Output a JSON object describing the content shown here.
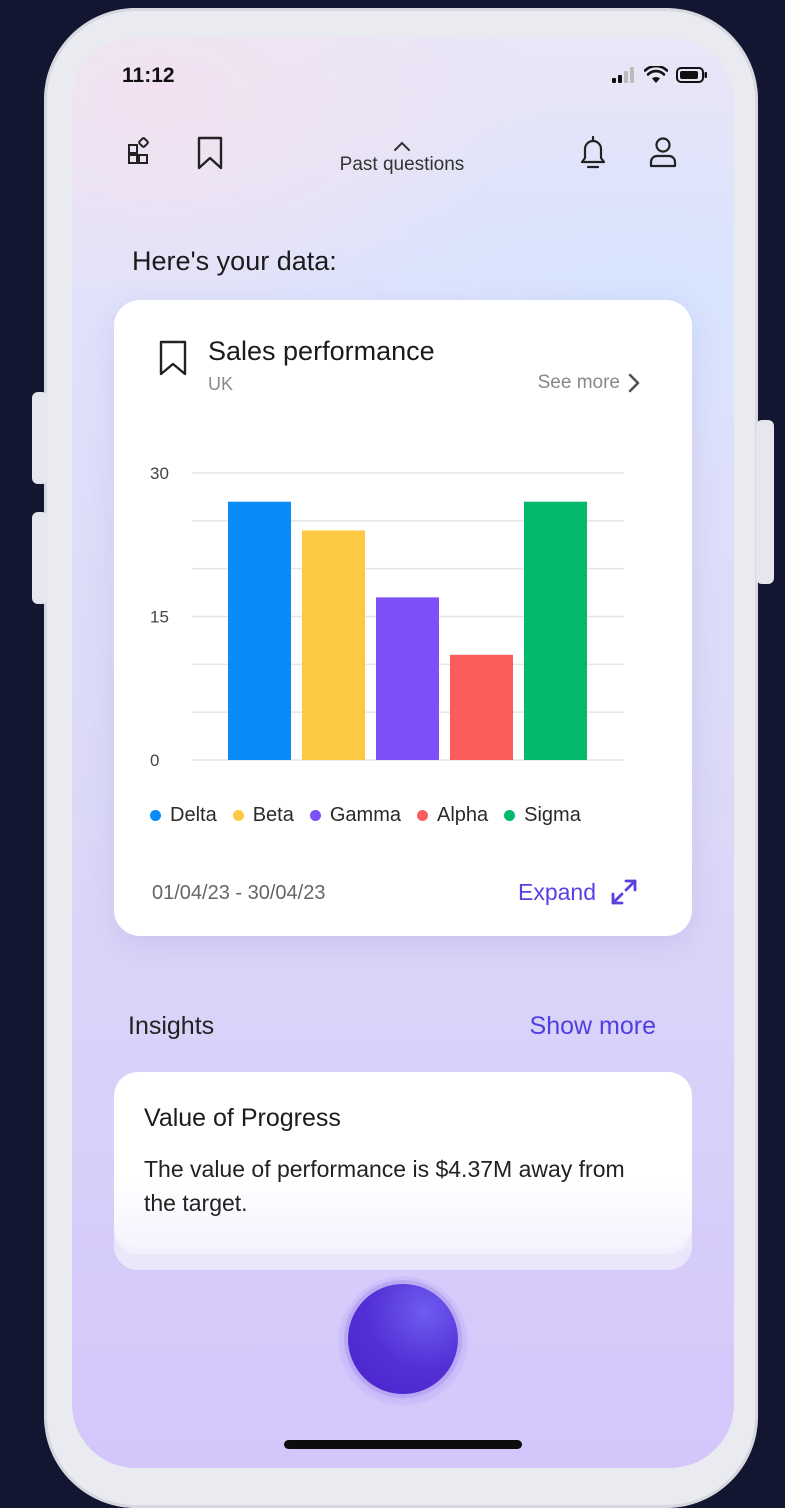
{
  "status_bar": {
    "time": "11:12"
  },
  "nav": {
    "past_questions_label": "Past questions"
  },
  "heading": "Here's your data:",
  "card": {
    "title": "Sales performance",
    "subtitle": "UK",
    "see_more_label": "See more",
    "date_range": "01/04/23 - 30/04/23",
    "expand_label": "Expand"
  },
  "chart_data": {
    "type": "bar",
    "categories": [
      "Delta",
      "Beta",
      "Gamma",
      "Alpha",
      "Sigma"
    ],
    "values": [
      27,
      24,
      17,
      11,
      27
    ],
    "colors": [
      "#0a8cf8",
      "#fdc942",
      "#7b50f7",
      "#fb5d5d",
      "#03b96b"
    ],
    "ylim": [
      0,
      30
    ],
    "yticks": [
      0,
      15,
      30
    ],
    "grid": true,
    "legend_position": "bottom"
  },
  "insights": {
    "title": "Insights",
    "show_more_label": "Show more",
    "card_title": "Value of Progress",
    "card_body": "The value of performance is $4.37M away from the target."
  },
  "colors": {
    "accent": "#5b3fe3",
    "link": "#4f3fe0"
  }
}
